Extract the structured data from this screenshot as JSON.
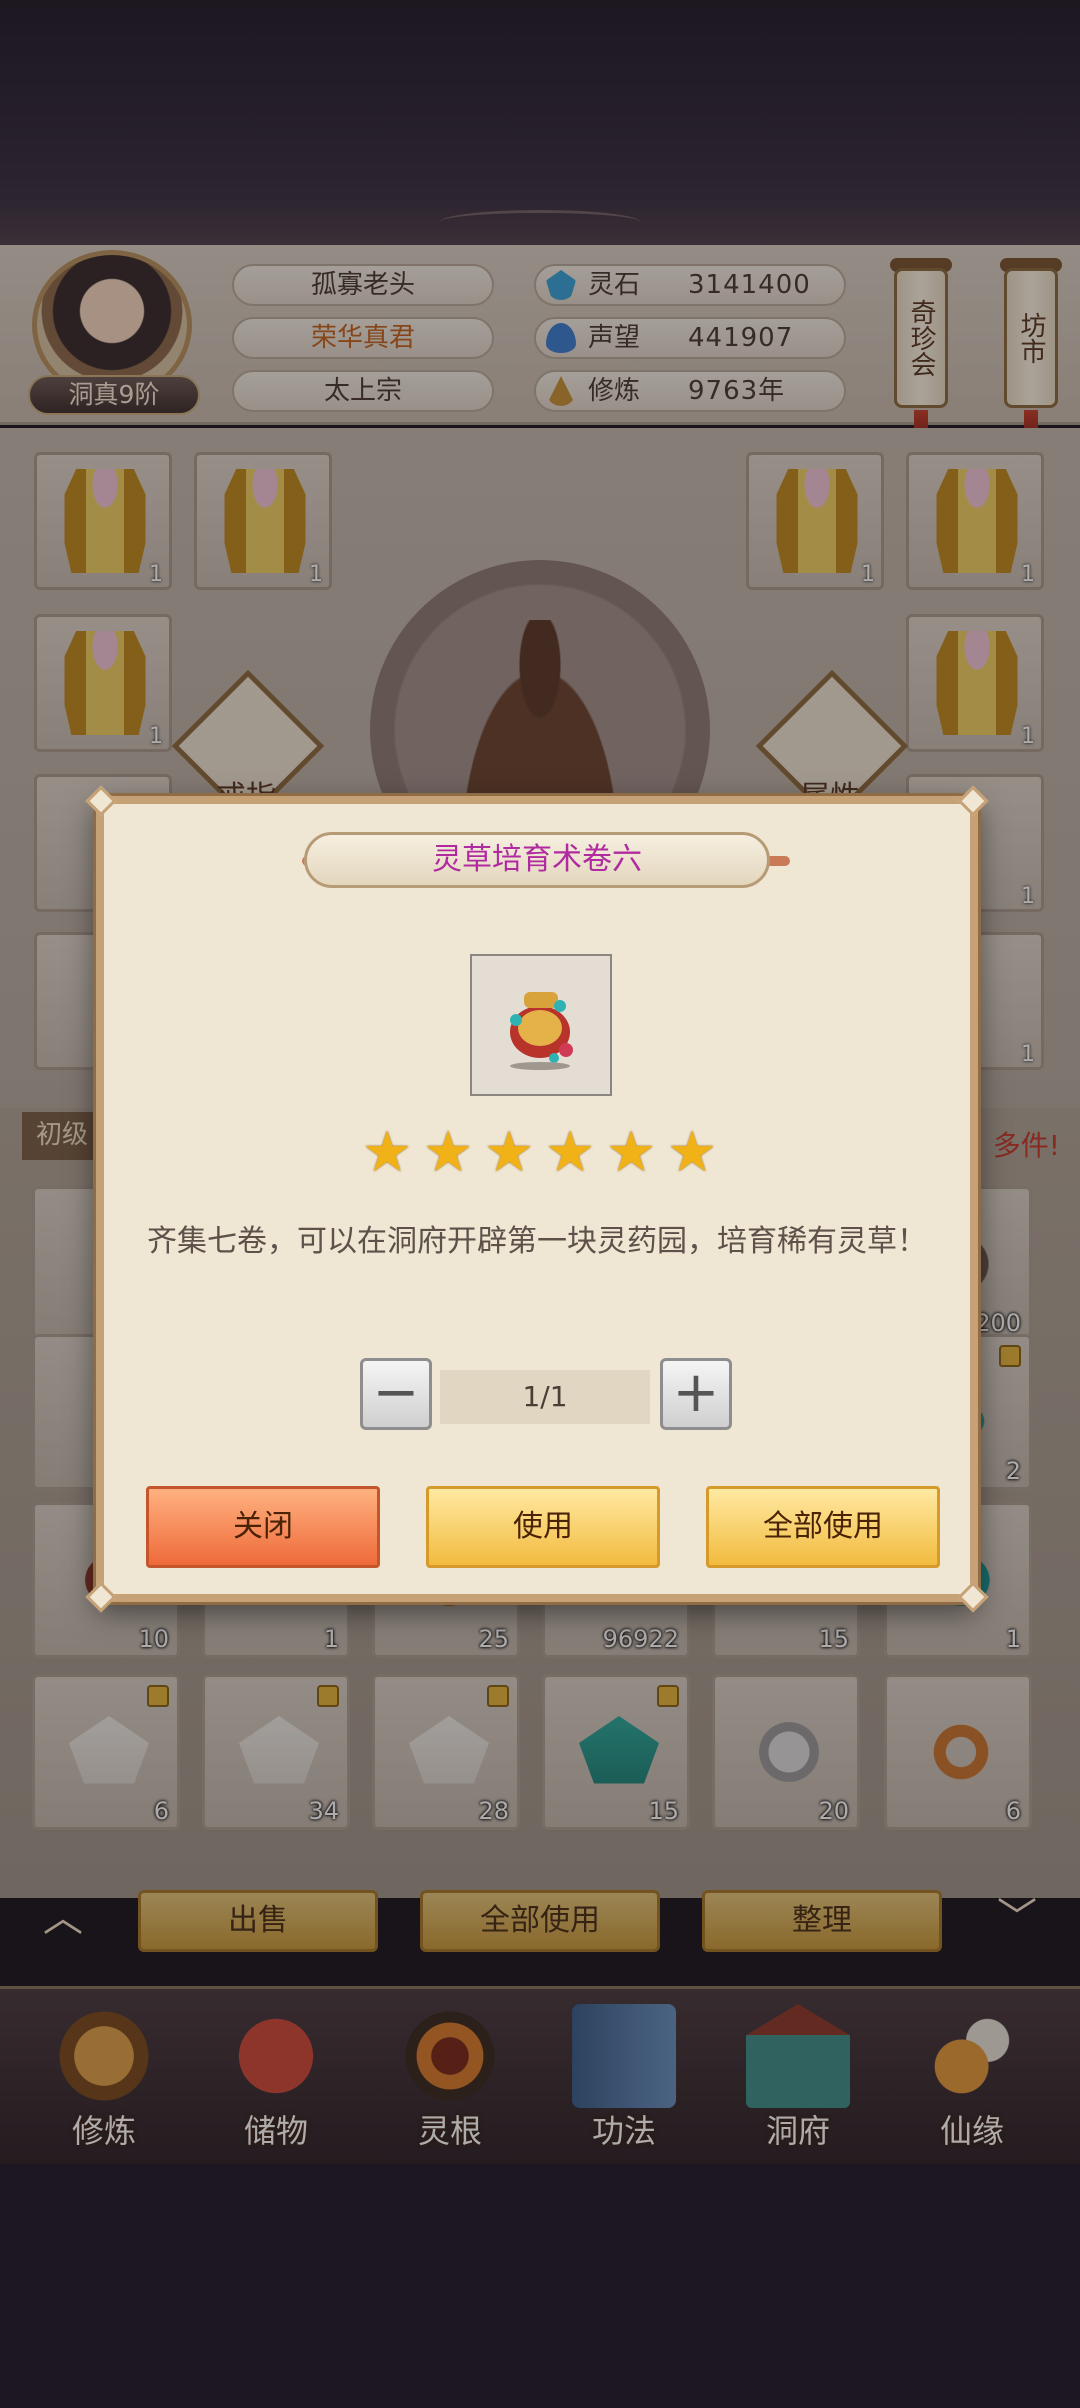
{
  "player": {
    "realm": "洞真9阶",
    "name": "孤寡老头",
    "title": "荣华真君",
    "sect": "太上宗",
    "stats": [
      {
        "label": "灵石",
        "value": "3141400",
        "icon": "spirit-stone-icon",
        "color": "#3aa4d8"
      },
      {
        "label": "声望",
        "value": "441907",
        "icon": "reputation-icon",
        "color": "#3c7fd0"
      },
      {
        "label": "修炼",
        "value": "9763年",
        "icon": "meditation-icon",
        "color": "#c7923a"
      }
    ]
  },
  "side_buttons": {
    "treasure_fair": "奇珍会",
    "market": "坊市"
  },
  "equipment": {
    "slot_count": "1",
    "ring_label": "戒指",
    "attributes_label": "属性"
  },
  "inventory": {
    "tab_label": "初级",
    "hint": "多件!",
    "row1": [
      "200",
      "2"
    ],
    "row2": [
      "10",
      "1",
      "25",
      "96922",
      "15",
      "1"
    ],
    "row3": [
      "6",
      "34",
      "28",
      "15",
      "20",
      "6"
    ],
    "actions": {
      "sell": "出售",
      "use_all": "全部使用",
      "sort": "整理"
    }
  },
  "nav": [
    {
      "label": "修炼",
      "icon": "cultivation-icon"
    },
    {
      "label": "储物",
      "icon": "storage-bag-icon"
    },
    {
      "label": "灵根",
      "icon": "spirit-root-icon"
    },
    {
      "label": "功法",
      "icon": "technique-book-icon"
    },
    {
      "label": "洞府",
      "icon": "cave-mansion-icon"
    },
    {
      "label": "仙缘",
      "icon": "immortal-fate-icon"
    }
  ],
  "modal": {
    "title": "灵草培育术卷六",
    "item_icon": "scroll-item-icon",
    "stars": 6,
    "star_char": "★",
    "description": "齐集七卷，可以在洞府开辟第一块灵药园，培育稀有灵草！",
    "quantity": "1/1",
    "minus": "−",
    "plus": "+",
    "close_label": "关闭",
    "use_label": "使用",
    "use_all_label": "全部使用"
  },
  "colors": {
    "title_magenta": "#b02aa0",
    "star_gold": "#f1b218",
    "hint_red": "#c43b2a"
  }
}
